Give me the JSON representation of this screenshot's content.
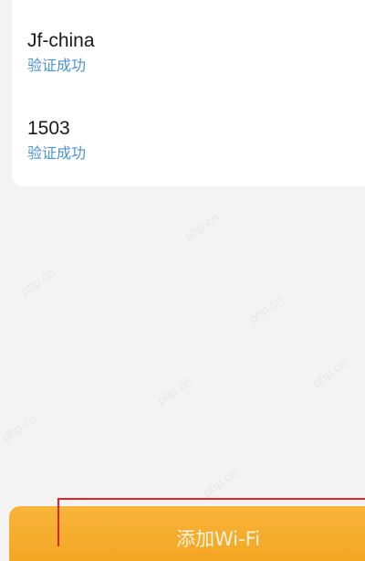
{
  "networks": [
    {
      "name": "Jf-china",
      "status": "验证成功"
    },
    {
      "name": "1503",
      "status": "验证成功"
    }
  ],
  "actions": {
    "add_wifi_label": "添加Wi-Fi"
  },
  "watermark": {
    "text": "php.cn"
  },
  "colors": {
    "background": "#f3f3f3",
    "card": "#ffffff",
    "status_text": "#4a93d2",
    "button": "#f5a623",
    "highlight": "#e02424"
  }
}
